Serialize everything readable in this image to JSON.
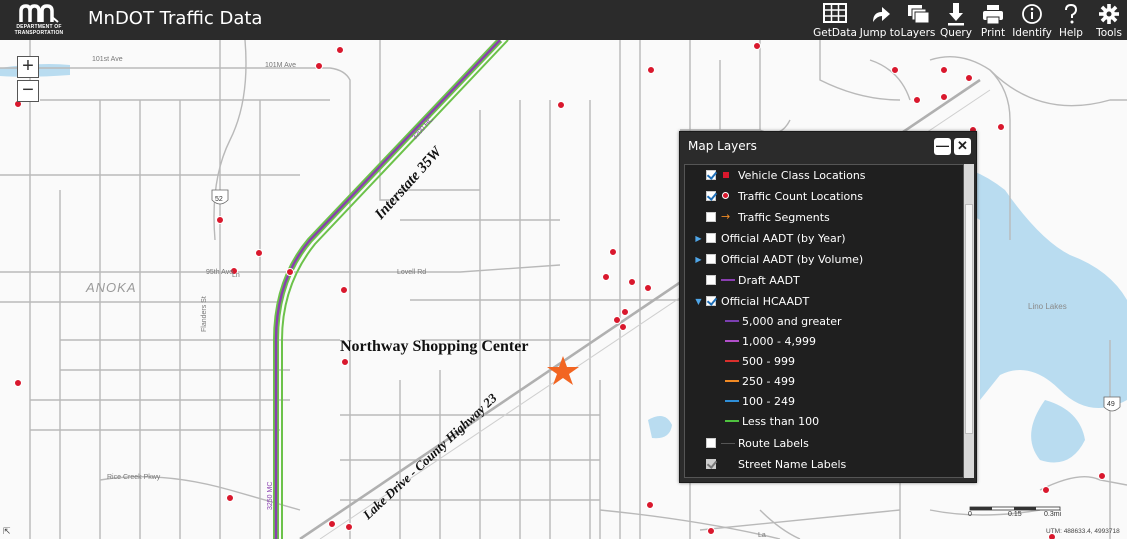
{
  "header": {
    "logo_mark": "mn",
    "logo_text_line1": "DEPARTMENT OF",
    "logo_text_line2": "TRANSPORTATION",
    "title": "MnDOT Traffic Data"
  },
  "toolbar": [
    {
      "key": "getdata",
      "label": "GetData",
      "icon": "table-icon"
    },
    {
      "key": "jumpto",
      "label": "Jump to",
      "icon": "jump-arrow-icon"
    },
    {
      "key": "layers",
      "label": "Layers",
      "icon": "layers-icon"
    },
    {
      "key": "query",
      "label": "Query",
      "icon": "download-arrow-icon"
    },
    {
      "key": "print",
      "label": "Print",
      "icon": "printer-icon"
    },
    {
      "key": "identify",
      "label": "Identify",
      "icon": "info-icon"
    },
    {
      "key": "help",
      "label": "Help",
      "icon": "question-icon"
    },
    {
      "key": "tools",
      "label": "Tools",
      "icon": "gear-icon"
    }
  ],
  "map": {
    "zoom_in": "+",
    "zoom_out": "−",
    "labels": {
      "street_101st": "101st Ave",
      "street_101m": "101M Ave",
      "street_95th": "95th Ave",
      "street_lovell": "Lovell Rd",
      "street_ln": "Ln",
      "shield_52": "52",
      "shield_49": "49",
      "anoka": "ANOKA",
      "lino_lakes": "Lino Lakes",
      "rice_creek": "Rice Creek Pkwy",
      "fladers": "Flanders St",
      "lane_la": "La",
      "interstate_label": "Interstate 35W",
      "interstate_volume": "3200 HC",
      "interstate_volume2": "3250 MC",
      "shopping_center": "Northway Shopping Center",
      "highway_label": "Lake Drive - County Highway 23",
      "scale_0": "0",
      "scale_mid": "0.15",
      "scale_end": "0.3mi",
      "utm_readout": "UTM: 488633.4, 4993718"
    },
    "colors": {
      "count_location": "#d9182d",
      "star": "#f26522",
      "water": "#b9dcf0",
      "interstate_purple": "#8a3fb0",
      "interstate_green": "#6cc24a"
    }
  },
  "layers_panel": {
    "title": "Map Layers",
    "minimize": "—",
    "close": "✕",
    "items": [
      {
        "label": "Vehicle Class Locations",
        "checked": "on",
        "symbol": "red-square"
      },
      {
        "label": "Traffic Count Locations",
        "checked": "on",
        "symbol": "red-circle"
      },
      {
        "label": "Traffic Segments",
        "checked": "off",
        "symbol": "orange-arrow"
      },
      {
        "label": "Official AADT (by Year)",
        "checked": "off",
        "symbol": "expander"
      },
      {
        "label": "Official AADT (by Volume)",
        "checked": "off",
        "symbol": "expander"
      },
      {
        "label": "Draft AADT",
        "checked": "off",
        "symbol": "purple-line"
      },
      {
        "label": "Official HCAADT",
        "checked": "on",
        "symbol": "expanded"
      }
    ],
    "legend": [
      {
        "label": "5,000 and greater",
        "color": "#7b3fb0"
      },
      {
        "label": "1,000 - 4,999",
        "color": "#b14fc9"
      },
      {
        "label": "500 - 999",
        "color": "#d9302d"
      },
      {
        "label": "250 - 499",
        "color": "#f08a24"
      },
      {
        "label": "100 - 249",
        "color": "#2f8fd8"
      },
      {
        "label": "Less than 100",
        "color": "#4fc23f"
      }
    ],
    "extra": [
      {
        "label": "Route Labels",
        "checked": "off"
      },
      {
        "label": "Street Name Labels",
        "checked": "disabled"
      }
    ]
  }
}
